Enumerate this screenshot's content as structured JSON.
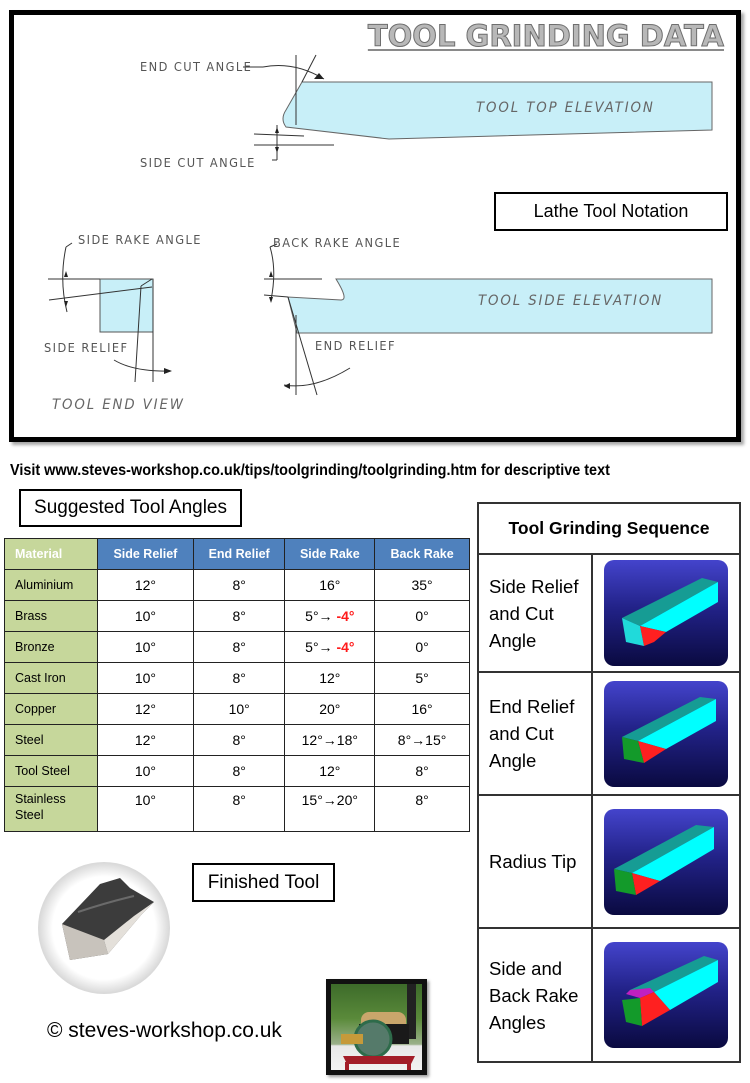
{
  "title": "TOOL GRINDING DATA",
  "diagram": {
    "labels": {
      "end_cut_angle": "END CUT ANGLE",
      "side_cut_angle": "SIDE CUT ANGLE",
      "tool_top_elevation": "TOOL TOP ELEVATION",
      "side_rake_angle": "SIDE RAKE ANGLE",
      "back_rake_angle": "BACK RAKE ANGLE",
      "tool_side_elevation": "TOOL SIDE ELEVATION",
      "side_relief": "SIDE RELIEF",
      "end_relief": "END RELIEF",
      "tool_end_view": "TOOL END VIEW"
    },
    "notation_box": "Lathe Tool Notation",
    "fill_color": "#c8eff8"
  },
  "visit_text": "Visit  www.steves-workshop.co.uk/tips/toolgrinding/toolgrinding.htm for descriptive text",
  "angles_table": {
    "heading": "Suggested Tool Angles",
    "columns": [
      "Material",
      "Side Relief",
      "End Relief",
      "Side Rake",
      "Back Rake"
    ],
    "rows": [
      {
        "material": "Aluminium",
        "side_relief": "12°",
        "end_relief": "8°",
        "side_rake": "16°",
        "side_rake_neg": "",
        "back_rake": "35°"
      },
      {
        "material": "Brass",
        "side_relief": "10°",
        "end_relief": "8°",
        "side_rake": "5°→ ",
        "side_rake_neg": "-4°",
        "back_rake": "0°"
      },
      {
        "material": "Bronze",
        "side_relief": "10°",
        "end_relief": "8°",
        "side_rake": "5°→ ",
        "side_rake_neg": "-4°",
        "back_rake": "0°"
      },
      {
        "material": "Cast Iron",
        "side_relief": "10°",
        "end_relief": "8°",
        "side_rake": "12°",
        "side_rake_neg": "",
        "back_rake": "5°"
      },
      {
        "material": "Copper",
        "side_relief": "12°",
        "end_relief": "10°",
        "side_rake": "20°",
        "side_rake_neg": "",
        "back_rake": "16°"
      },
      {
        "material": "Steel",
        "side_relief": "12°",
        "end_relief": "8°",
        "side_rake": "12°→18°",
        "side_rake_neg": "",
        "back_rake": "8°→15°"
      },
      {
        "material": "Tool Steel",
        "side_relief": "10°",
        "end_relief": "8°",
        "side_rake": "12°",
        "side_rake_neg": "",
        "back_rake": "8°"
      },
      {
        "material": "Stainless Steel",
        "side_relief": "10°",
        "end_relief": "8°",
        "side_rake": "15°→20°",
        "side_rake_neg": "",
        "back_rake": "8°"
      }
    ],
    "colors": {
      "material_bg": "#c6d79b",
      "header_bg": "#4f81bd",
      "negative": "#ff1a1a"
    }
  },
  "finished_tool": {
    "label": "Finished Tool"
  },
  "copyright": "© steves-workshop.co.uk",
  "sequence": {
    "heading": "Tool Grinding Sequence",
    "steps": [
      {
        "label": "Side Relief and Cut Angle",
        "icon": "tool-blank-side-relief-icon"
      },
      {
        "label": "End Relief and Cut Angle",
        "icon": "tool-blank-end-relief-icon"
      },
      {
        "label": "Radius Tip",
        "icon": "tool-blank-radius-tip-icon"
      },
      {
        "label": "Side and Back Rake Angles",
        "icon": "tool-blank-rake-icon"
      }
    ]
  }
}
